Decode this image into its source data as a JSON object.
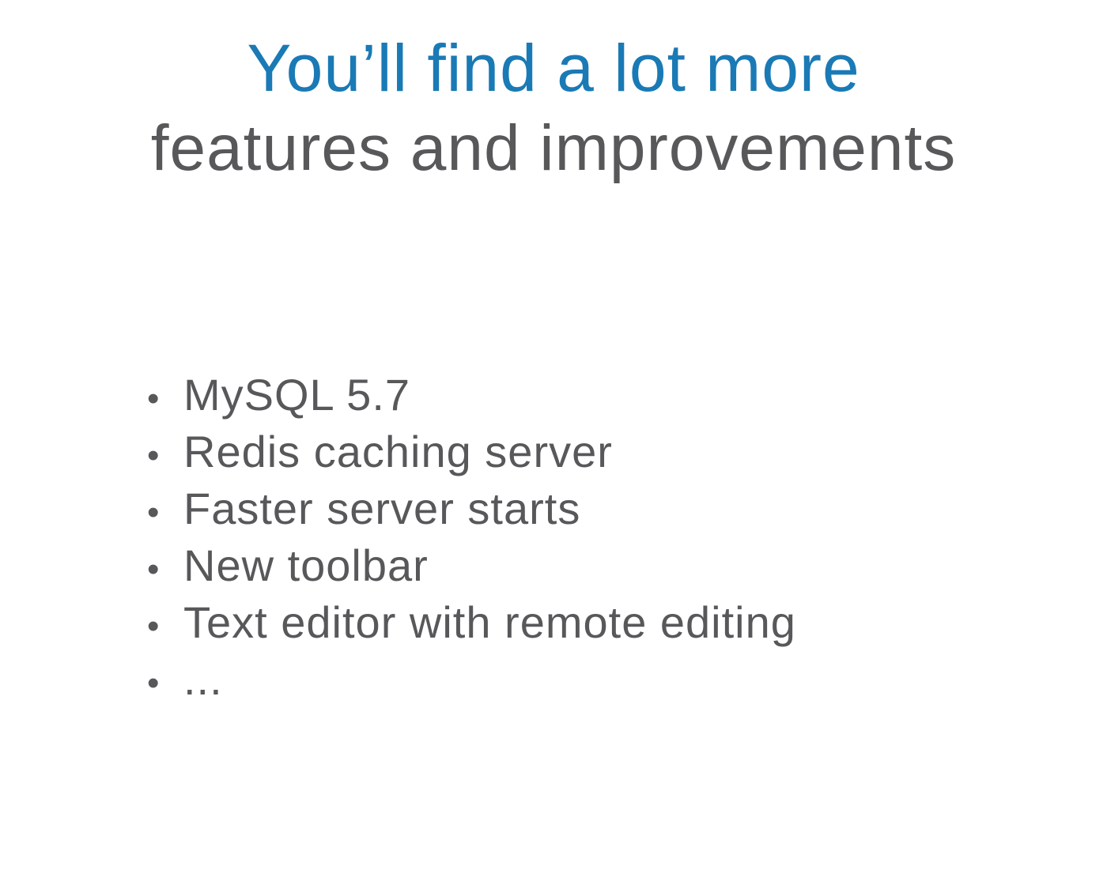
{
  "colors": {
    "heading_accent": "#1a7ab5",
    "body_text": "#58585b",
    "background": "#ffffff"
  },
  "heading": {
    "line1": "You’ll find a lot more",
    "line2": "features and improvements"
  },
  "features": {
    "bullet_glyph": "•",
    "items": [
      "MySQL 5.7",
      "Redis caching server",
      "Faster server starts",
      "New toolbar",
      "Text editor with remote editing",
      "..."
    ]
  }
}
